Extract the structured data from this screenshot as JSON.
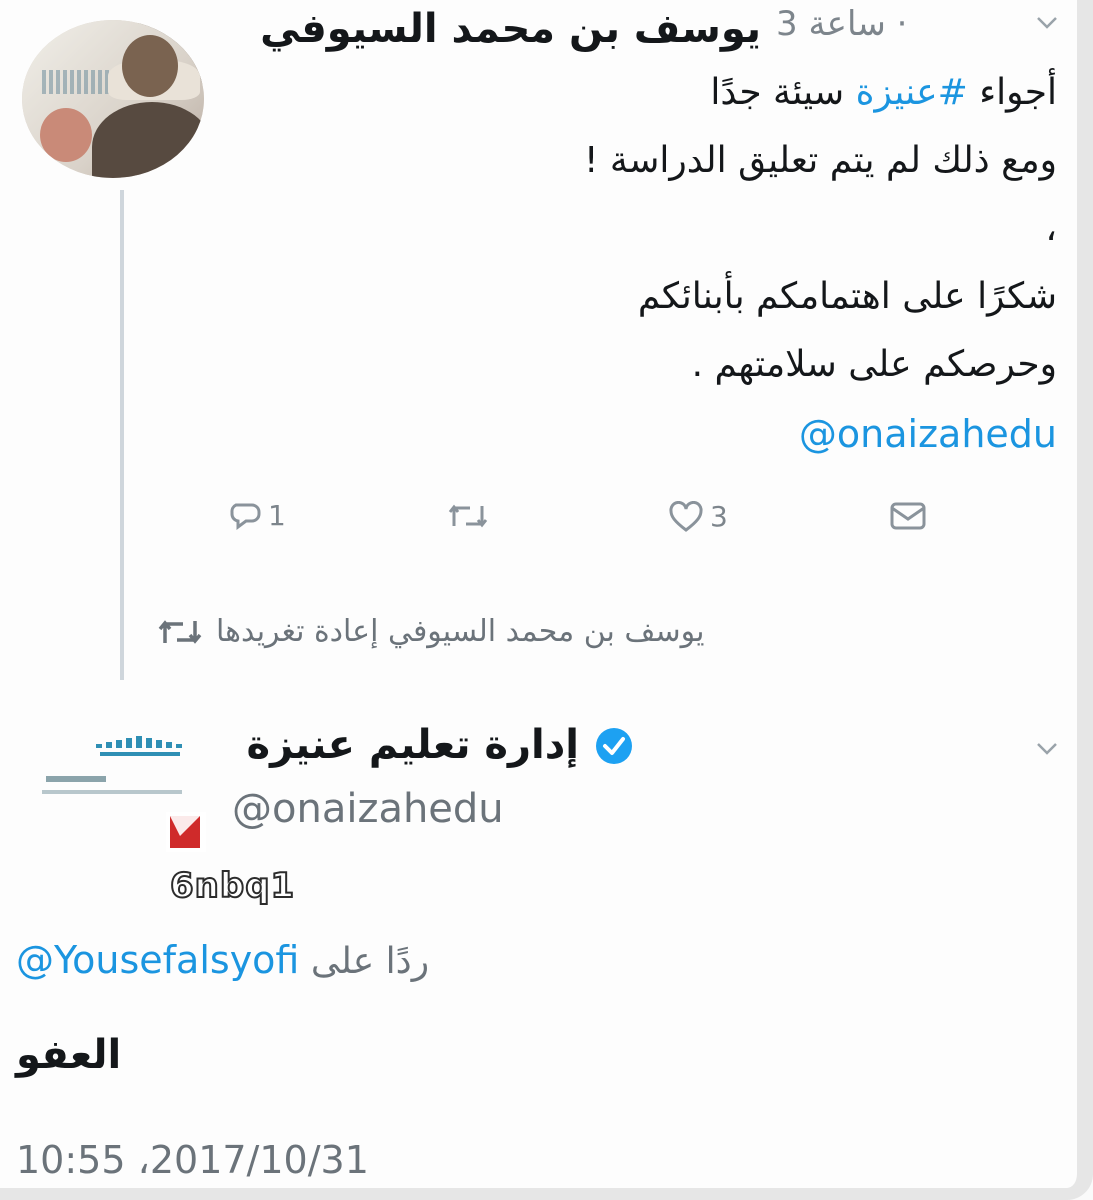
{
  "tweet1": {
    "author": "يوسف بن محمد السيوفي",
    "time_ago": "3 ساعة",
    "lines": [
      {
        "before": "أجواء ",
        "hashtag": "#عنيزة",
        "after": " سيئة جدًا"
      },
      {
        "text": "ومع ذلك لم يتم تعليق الدراسة !"
      },
      {
        "text": "،"
      },
      {
        "text": "شكرًا على اهتمامكم بأبنائكم"
      },
      {
        "text": "وحرصكم على سلامتهم ."
      }
    ],
    "mention": "@onaizahedu",
    "reply_count": "1",
    "like_count": "3",
    "icons": [
      "reply-icon",
      "retweet-icon",
      "like-icon",
      "direct-message-icon"
    ]
  },
  "retweet_context": {
    "text": "يوسف بن محمد السيوفي إعادة تغريدها"
  },
  "tweet2": {
    "author": "إدارة تعليم عنيزة",
    "verified": true,
    "handle": "@onaizahedu",
    "replying_label": "ردًا على",
    "replying_to": "@Yousefalsyofi",
    "text": "العفو",
    "timestamp": "10:55 ،2017/10/31"
  },
  "watermark": "6nbq1",
  "colors": {
    "link": "#1b95e0",
    "muted": "#6b737a",
    "text": "#14171a",
    "verified": "#1da1f2"
  }
}
